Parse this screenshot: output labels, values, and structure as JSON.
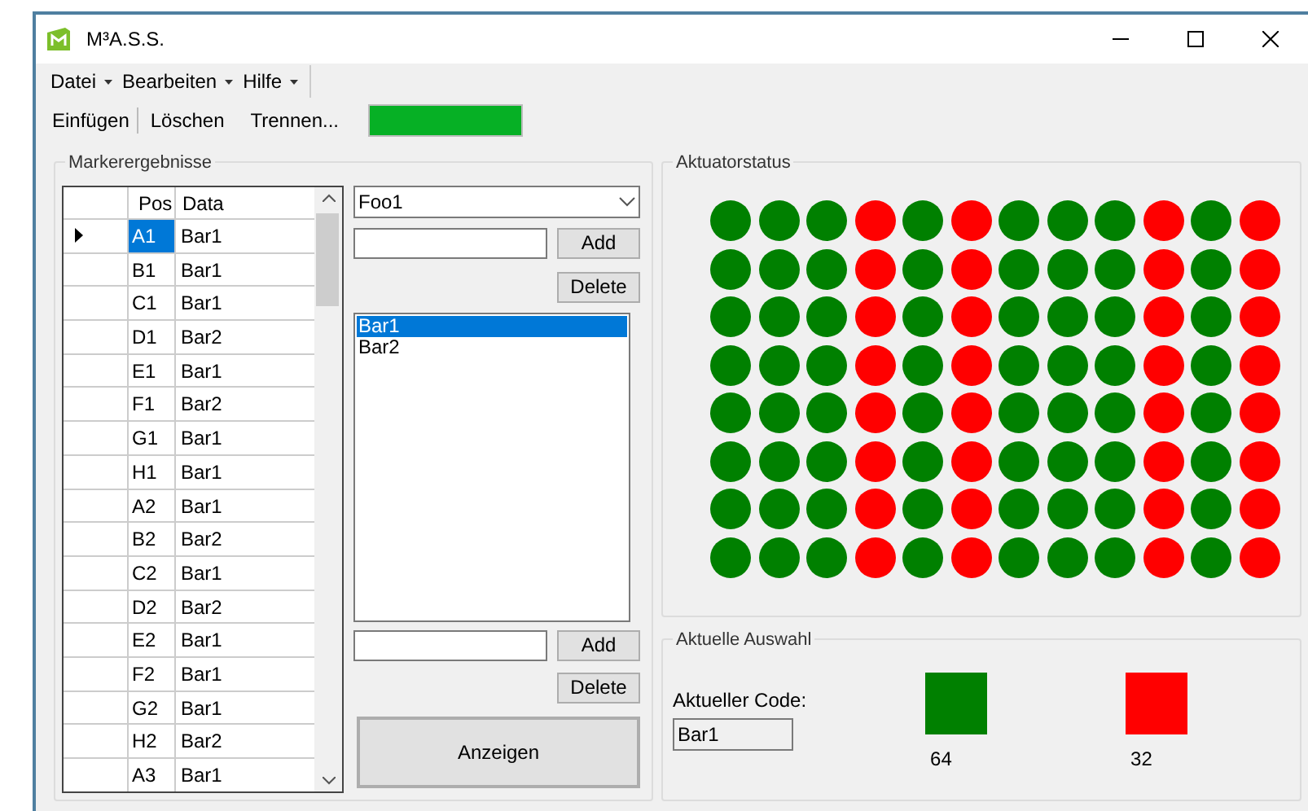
{
  "window": {
    "title": "M³A.S.S."
  },
  "menu": [
    "Datei",
    "Bearbeiten",
    "Hilfe"
  ],
  "toolbar": {
    "items": [
      {
        "label": "Einfügen",
        "separator_after": true
      },
      {
        "label": "Löschen",
        "separator_after": false
      },
      {
        "label": "Trennen...",
        "separator_after": false
      }
    ],
    "progress": {
      "level": 1
    }
  },
  "marker_group": {
    "title": "Markerergebnisse",
    "table": {
      "columns": [
        "Pos",
        "Data"
      ],
      "rows": [
        {
          "pos": "A1",
          "data": "Bar1",
          "selected": true
        },
        {
          "pos": "B1",
          "data": "Bar1",
          "selected": false
        },
        {
          "pos": "C1",
          "data": "Bar1",
          "selected": false
        },
        {
          "pos": "D1",
          "data": "Bar2",
          "selected": false
        },
        {
          "pos": "E1",
          "data": "Bar1",
          "selected": false
        },
        {
          "pos": "F1",
          "data": "Bar2",
          "selected": false
        },
        {
          "pos": "G1",
          "data": "Bar1",
          "selected": false
        },
        {
          "pos": "H1",
          "data": "Bar1",
          "selected": false
        },
        {
          "pos": "A2",
          "data": "Bar1",
          "selected": false
        },
        {
          "pos": "B2",
          "data": "Bar2",
          "selected": false
        },
        {
          "pos": "C2",
          "data": "Bar1",
          "selected": false
        },
        {
          "pos": "D2",
          "data": "Bar2",
          "selected": false
        },
        {
          "pos": "E2",
          "data": "Bar1",
          "selected": false
        },
        {
          "pos": "F2",
          "data": "Bar1",
          "selected": false
        },
        {
          "pos": "G2",
          "data": "Bar1",
          "selected": false
        },
        {
          "pos": "H2",
          "data": "Bar2",
          "selected": false
        },
        {
          "pos": "A3",
          "data": "Bar1",
          "selected": false
        }
      ]
    },
    "dropdown": {
      "value": "Foo1"
    },
    "add_buttons": [
      "Add",
      "Add"
    ],
    "delete_buttons": [
      "Delete",
      "Delete"
    ],
    "list": [
      {
        "label": "Bar1",
        "selected": true
      },
      {
        "label": "Bar2",
        "selected": false
      }
    ],
    "show_button": "Anzeigen"
  },
  "actuator_group": {
    "title": "Aktuatorstatus",
    "rows": [
      [
        {
          "color": "#008000"
        },
        {
          "color": "#008000"
        },
        {
          "color": "#008000"
        },
        {
          "color": "#ff0000"
        },
        {
          "color": "#008000"
        },
        {
          "color": "#ff0000"
        },
        {
          "color": "#008000"
        },
        {
          "color": "#008000"
        },
        {
          "color": "#008000"
        },
        {
          "color": "#ff0000"
        },
        {
          "color": "#008000"
        },
        {
          "color": "#ff0000"
        }
      ],
      [
        {
          "color": "#008000"
        },
        {
          "color": "#008000"
        },
        {
          "color": "#008000"
        },
        {
          "color": "#ff0000"
        },
        {
          "color": "#008000"
        },
        {
          "color": "#ff0000"
        },
        {
          "color": "#008000"
        },
        {
          "color": "#008000"
        },
        {
          "color": "#008000"
        },
        {
          "color": "#ff0000"
        },
        {
          "color": "#008000"
        },
        {
          "color": "#ff0000"
        }
      ],
      [
        {
          "color": "#008000"
        },
        {
          "color": "#008000"
        },
        {
          "color": "#008000"
        },
        {
          "color": "#ff0000"
        },
        {
          "color": "#008000"
        },
        {
          "color": "#ff0000"
        },
        {
          "color": "#008000"
        },
        {
          "color": "#008000"
        },
        {
          "color": "#008000"
        },
        {
          "color": "#ff0000"
        },
        {
          "color": "#008000"
        },
        {
          "color": "#ff0000"
        }
      ],
      [
        {
          "color": "#008000"
        },
        {
          "color": "#008000"
        },
        {
          "color": "#008000"
        },
        {
          "color": "#ff0000"
        },
        {
          "color": "#008000"
        },
        {
          "color": "#ff0000"
        },
        {
          "color": "#008000"
        },
        {
          "color": "#008000"
        },
        {
          "color": "#008000"
        },
        {
          "color": "#ff0000"
        },
        {
          "color": "#008000"
        },
        {
          "color": "#ff0000"
        }
      ],
      [
        {
          "color": "#008000"
        },
        {
          "color": "#008000"
        },
        {
          "color": "#008000"
        },
        {
          "color": "#ff0000"
        },
        {
          "color": "#008000"
        },
        {
          "color": "#ff0000"
        },
        {
          "color": "#008000"
        },
        {
          "color": "#008000"
        },
        {
          "color": "#008000"
        },
        {
          "color": "#ff0000"
        },
        {
          "color": "#008000"
        },
        {
          "color": "#ff0000"
        }
      ],
      [
        {
          "color": "#008000"
        },
        {
          "color": "#008000"
        },
        {
          "color": "#008000"
        },
        {
          "color": "#ff0000"
        },
        {
          "color": "#008000"
        },
        {
          "color": "#ff0000"
        },
        {
          "color": "#008000"
        },
        {
          "color": "#008000"
        },
        {
          "color": "#008000"
        },
        {
          "color": "#ff0000"
        },
        {
          "color": "#008000"
        },
        {
          "color": "#ff0000"
        }
      ],
      [
        {
          "color": "#008000"
        },
        {
          "color": "#008000"
        },
        {
          "color": "#008000"
        },
        {
          "color": "#ff0000"
        },
        {
          "color": "#008000"
        },
        {
          "color": "#ff0000"
        },
        {
          "color": "#008000"
        },
        {
          "color": "#008000"
        },
        {
          "color": "#008000"
        },
        {
          "color": "#ff0000"
        },
        {
          "color": "#008000"
        },
        {
          "color": "#ff0000"
        }
      ],
      [
        {
          "color": "#008000"
        },
        {
          "color": "#008000"
        },
        {
          "color": "#008000"
        },
        {
          "color": "#ff0000"
        },
        {
          "color": "#008000"
        },
        {
          "color": "#ff0000"
        },
        {
          "color": "#008000"
        },
        {
          "color": "#008000"
        },
        {
          "color": "#008000"
        },
        {
          "color": "#ff0000"
        },
        {
          "color": "#008000"
        },
        {
          "color": "#ff0000"
        }
      ]
    ]
  },
  "selection_group": {
    "title": "Aktuelle Auswahl",
    "code_label": "Aktueller Code:",
    "code_value": "Bar1",
    "counts": [
      {
        "color": "#008000",
        "count": "64"
      },
      {
        "color": "#ff0000",
        "count": "32"
      }
    ]
  }
}
